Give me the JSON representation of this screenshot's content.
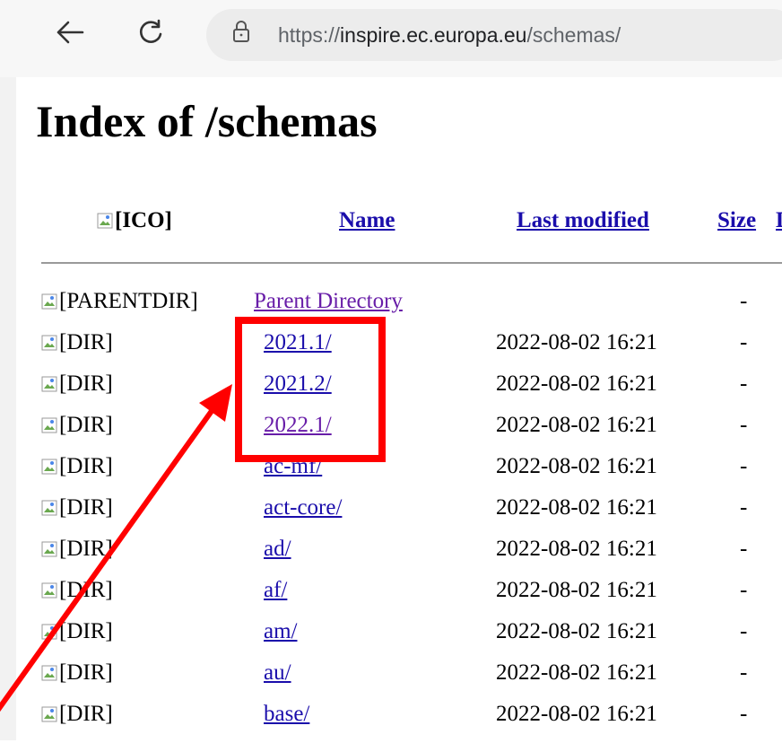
{
  "browser": {
    "url_host": "inspire.ec.europa.eu",
    "url_prefix": "https://",
    "url_path": "/schemas/"
  },
  "page": {
    "title": "Index of /schemas",
    "columns": {
      "icon": "[ICO]",
      "name": "Name",
      "last_modified": "Last modified",
      "size": "Size",
      "description_partial": "D"
    },
    "rows": [
      {
        "icon_alt": "[PARENTDIR]",
        "name": "Parent Directory",
        "date": "",
        "size": "-"
      },
      {
        "icon_alt": "[DIR]",
        "name": "2021.1/",
        "date": "2022-08-02 16:21",
        "size": "-"
      },
      {
        "icon_alt": "[DIR]",
        "name": "2021.2/",
        "date": "2022-08-02 16:21",
        "size": "-"
      },
      {
        "icon_alt": "[DIR]",
        "name": "2022.1/",
        "date": "2022-08-02 16:21",
        "size": "-"
      },
      {
        "icon_alt": "[DIR]",
        "name": "ac-mf/",
        "date": "2022-08-02 16:21",
        "size": "-"
      },
      {
        "icon_alt": "[DIR]",
        "name": "act-core/",
        "date": "2022-08-02 16:21",
        "size": "-"
      },
      {
        "icon_alt": "[DIR]",
        "name": "ad/",
        "date": "2022-08-02 16:21",
        "size": "-"
      },
      {
        "icon_alt": "[DIR]",
        "name": "af/",
        "date": "2022-08-02 16:21",
        "size": "-"
      },
      {
        "icon_alt": "[DIR]",
        "name": "am/",
        "date": "2022-08-02 16:21",
        "size": "-"
      },
      {
        "icon_alt": "[DIR]",
        "name": "au/",
        "date": "2022-08-02 16:21",
        "size": "-"
      },
      {
        "icon_alt": "[DIR]",
        "name": "base/",
        "date": "2022-08-02 16:21",
        "size": "-"
      }
    ]
  },
  "annotation": {
    "highlight_color": "#ff0000"
  }
}
